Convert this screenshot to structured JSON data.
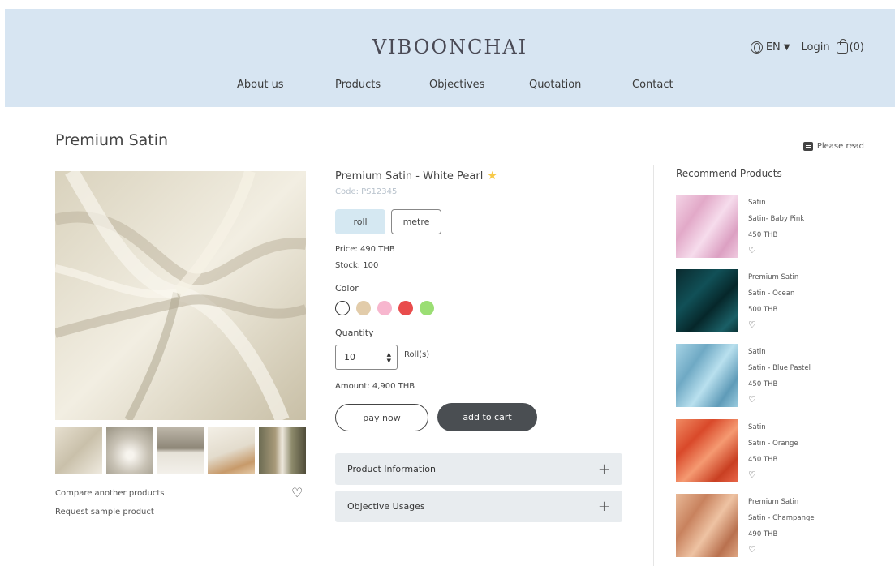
{
  "header": {
    "logo": "VIBOONCHAI",
    "nav": [
      "About us",
      "Products",
      "Objectives",
      "Quotation",
      "Contact"
    ],
    "language": "EN",
    "login": "Login",
    "cart_count": "(0)",
    "bg_color": "#d7e5f2"
  },
  "page": {
    "title": "Premium Satin",
    "please_read": "Please read"
  },
  "gallery": {
    "compare": "Compare another products",
    "request": "Request sample product"
  },
  "product": {
    "name": "Premium Satin - White Pearl",
    "code": "Code: PS12345",
    "units": [
      "roll",
      "metre"
    ],
    "selected_unit": "roll",
    "price": "Price: 490 THB",
    "stock": "Stock: 100",
    "color_label": "Color",
    "colors": [
      "#ffffff",
      "#e2ccaa",
      "#f7b6ce",
      "#e94c4c",
      "#9bde74"
    ],
    "quantity_label": "Quantity",
    "quantity": "10",
    "quantity_unit": "Roll(s)",
    "amount": "Amount: 4,900 THB",
    "pay_now": "pay now",
    "add_to_cart": "add to cart",
    "accordion": [
      "Product Information",
      "Objective Usages"
    ]
  },
  "recommend": {
    "title": "Recommend Products",
    "items": [
      {
        "category": "Satin",
        "name": "Satin- Baby Pink",
        "price": "450 THB",
        "color": "#ecbfd9"
      },
      {
        "category": "Premium Satin",
        "name": "Satin - Ocean",
        "price": "500 THB",
        "color": "#0d3c40"
      },
      {
        "category": "Satin",
        "name": "Satin - Blue Pastel",
        "price": "450 THB",
        "color": "#8fc2d8"
      },
      {
        "category": "Satin",
        "name": "Satin - Orange",
        "price": "450 THB",
        "color": "#e8643c"
      },
      {
        "category": "Premium Satin",
        "name": "Satin - Champange",
        "price": "490 THB",
        "color": "#d7a07c"
      }
    ]
  }
}
